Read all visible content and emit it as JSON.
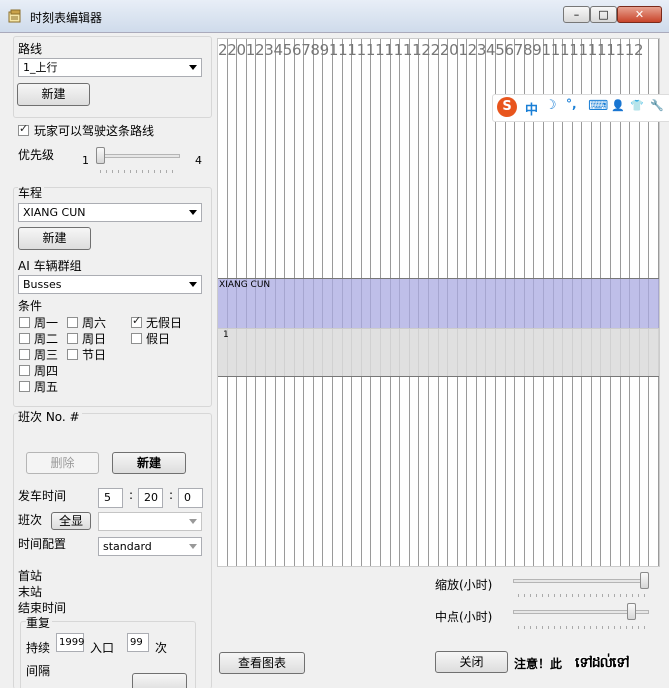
{
  "window": {
    "title": "时刻表编辑器",
    "controls": {
      "minimize": "–",
      "maximize": "□",
      "close": "✕"
    }
  },
  "route": {
    "label": "路线",
    "selected": "1_上行",
    "new_button": "新建",
    "player_drivable_label": "玩家可以驾驶这条路线",
    "player_drivable": true,
    "priority_label": "优先级",
    "priority_min": "1",
    "priority_max": "4",
    "priority_value": 1
  },
  "trip": {
    "label": "车程",
    "selected": "XIANG CUN",
    "new_button": "新建",
    "ai_group_label": "AI 车辆群组",
    "ai_group_selected": "Busses",
    "conditions_label": "条件",
    "conditions": [
      {
        "label": "周一",
        "checked": false
      },
      {
        "label": "周六",
        "checked": false
      },
      {
        "label": "无假日",
        "checked": true
      },
      {
        "label": "周二",
        "checked": false
      },
      {
        "label": "周日",
        "checked": false
      },
      {
        "label": "假日",
        "checked": false
      },
      {
        "label": "周三",
        "checked": false
      },
      {
        "label": "节日",
        "checked": false
      },
      {
        "label": "周四",
        "checked": false
      },
      {
        "label": "周五",
        "checked": false
      }
    ]
  },
  "run": {
    "label": "班次 No. #",
    "delete_button": "删除",
    "new_button": "新建",
    "departure_label": "发车时间",
    "departure_h": "5",
    "departure_m": "20",
    "departure_s": "0",
    "sep": ":",
    "shift_label": "班次",
    "show_all_button": "全显",
    "shift_selected": "",
    "time_config_label": "时间配置",
    "time_config_selected": "standard",
    "first_stop_label": "首站",
    "last_stop_label": "末站",
    "end_time_label": "结束时间",
    "repeat_label": "重复",
    "duration_label": "持续",
    "duration_value": "1999",
    "entry_label": "入口",
    "entry_value": "99",
    "times_label": "次",
    "interval_label": "间隔"
  },
  "timeline": {
    "header_text": "2201234567891111111111222012345678911111111112",
    "bars": [
      {
        "label": "XIANG CUN"
      },
      {
        "label": "1"
      }
    ]
  },
  "bottom": {
    "view_chart_button": "查看图表",
    "zoom_label": "缩放(小时)",
    "zoom_value": 1.0,
    "center_label": "中点(小时)",
    "center_value": 0.9,
    "close_button": "关闭",
    "note_prefix": "注意！此",
    "note_overlay": "ទៅដល់ទៅ"
  },
  "ime_bar": {
    "logo": "S",
    "items": [
      "中",
      "☽",
      "°,",
      "⌨",
      "👤",
      "👕",
      "🔧"
    ]
  }
}
